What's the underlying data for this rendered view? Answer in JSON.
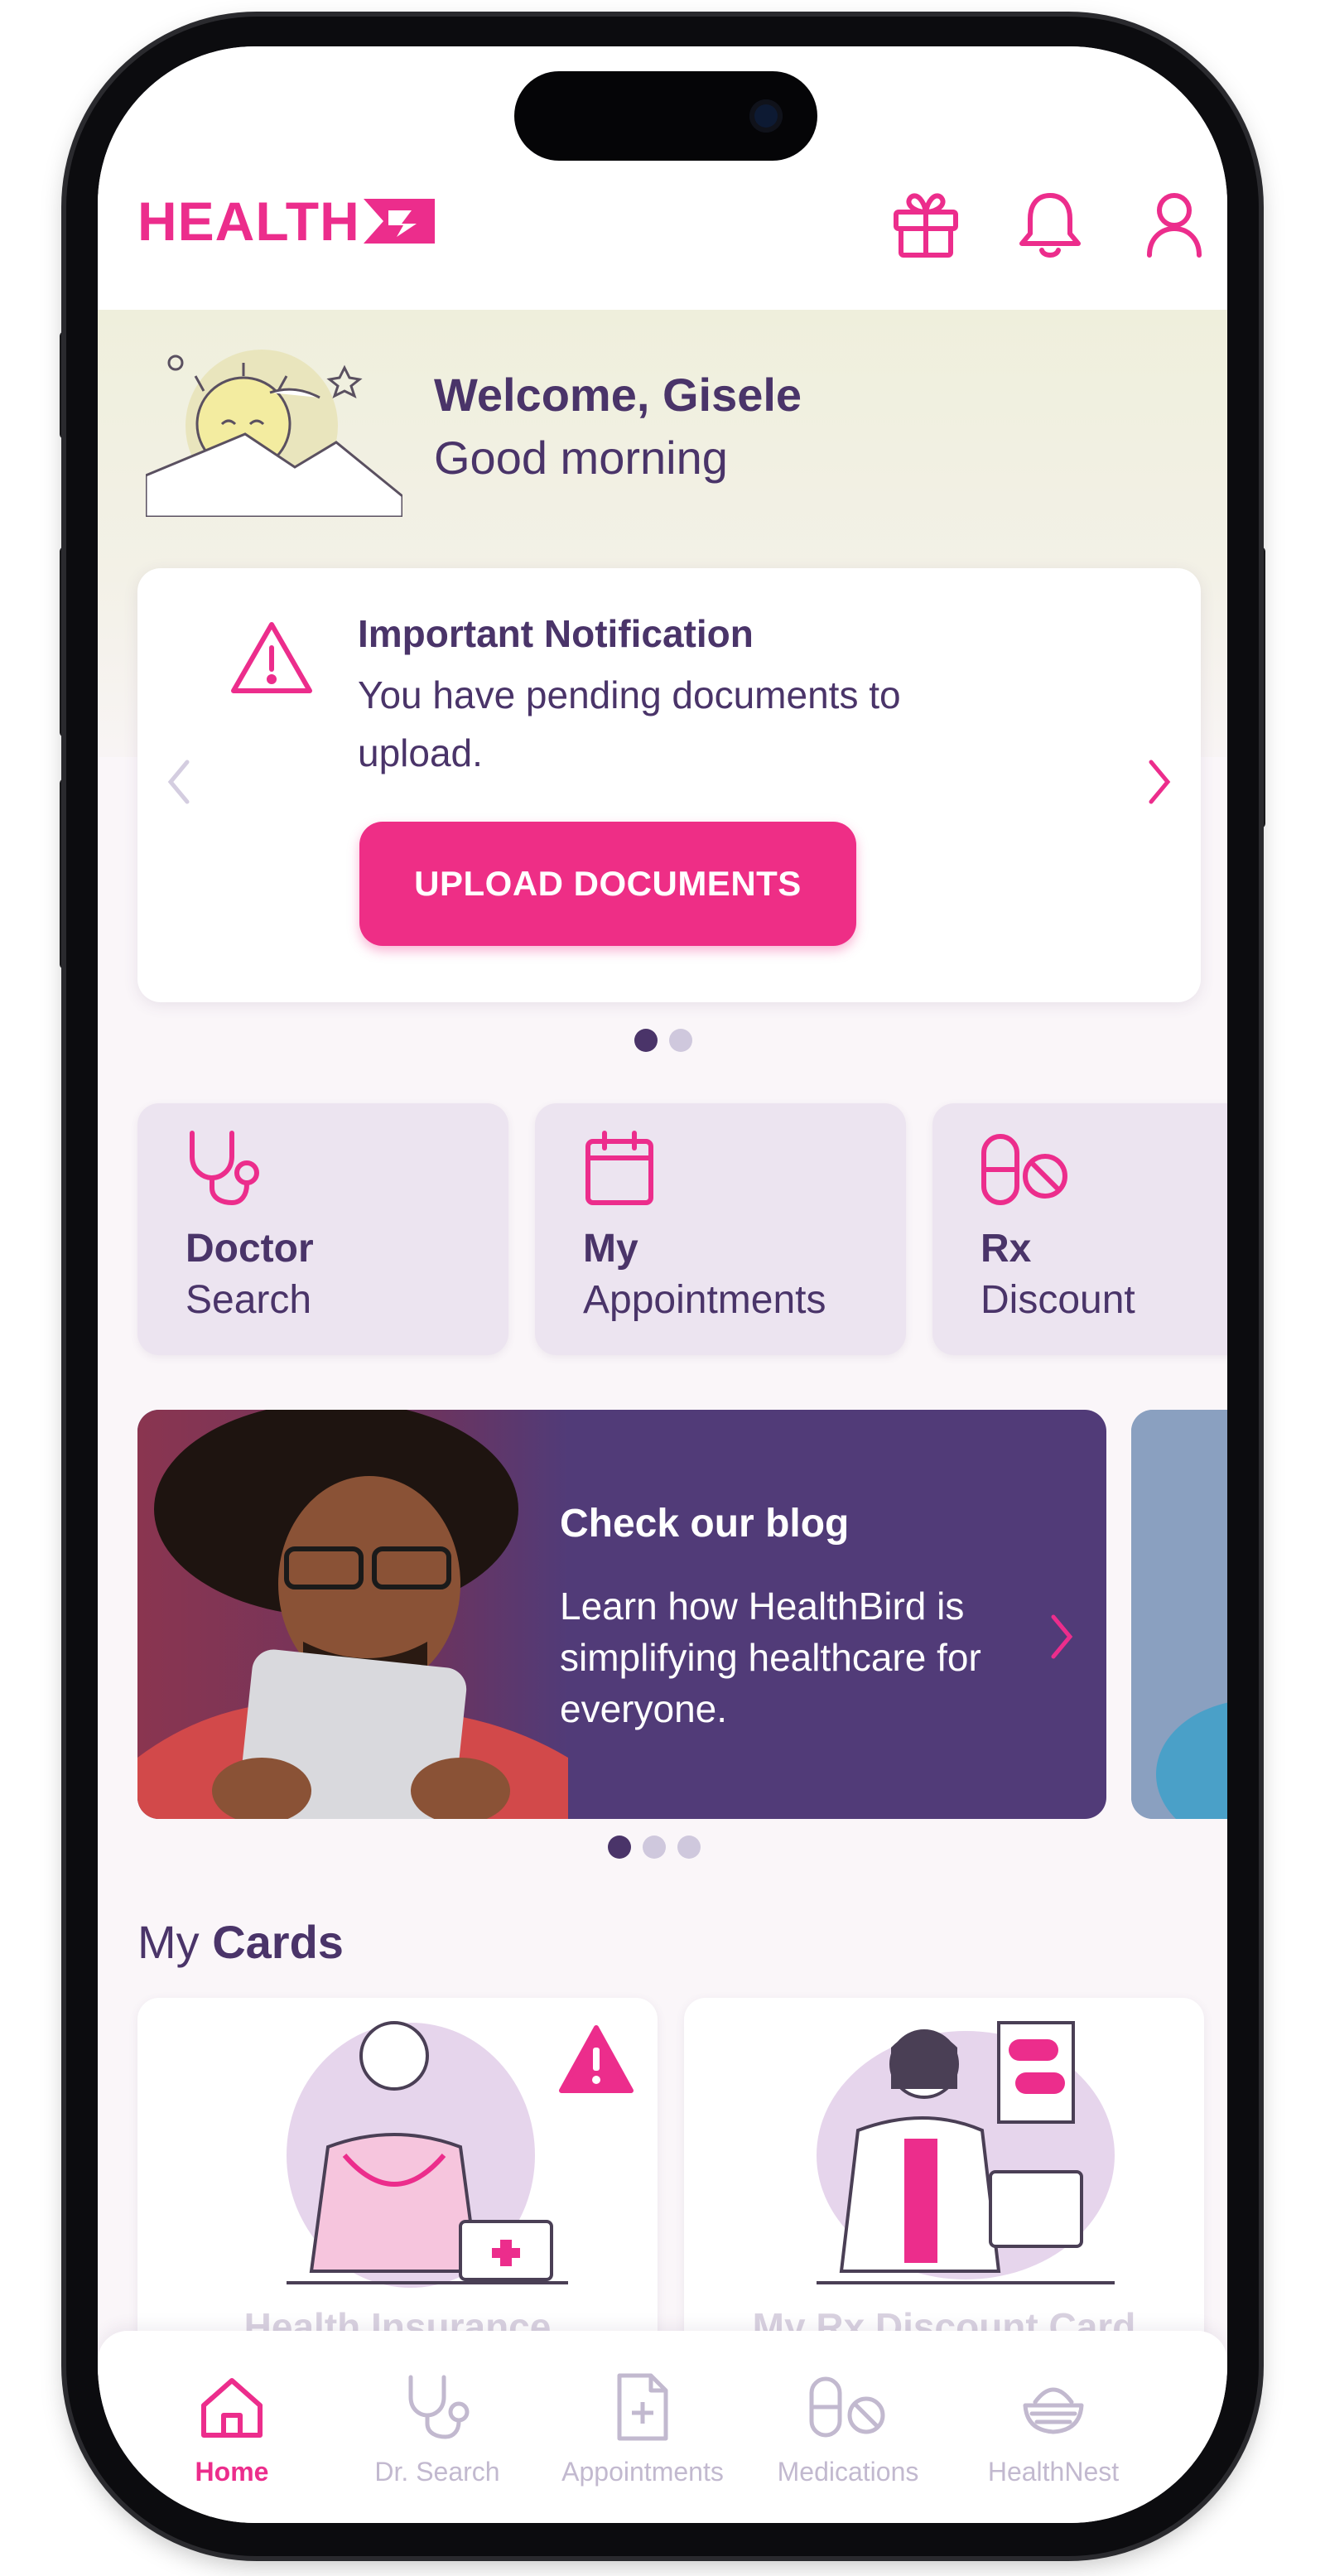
{
  "header": {
    "logo_text": "HEALTH",
    "icons": [
      "gift-icon",
      "bell-icon",
      "user-icon"
    ],
    "accent_color": "#ec2d8c"
  },
  "welcome": {
    "title": "Welcome, Gisele",
    "subtitle": "Good morning"
  },
  "notification": {
    "title": "Important Notification",
    "body": "You have pending documents to upload.",
    "button_label": "UPLOAD DOCUMENTS",
    "carousel_pages": 2,
    "carousel_active": 1
  },
  "quick_actions": [
    {
      "title": "Doctor",
      "subtitle": "Search",
      "icon": "stethoscope-icon"
    },
    {
      "title": "My",
      "subtitle": "Appointments",
      "icon": "calendar-icon"
    },
    {
      "title": "Rx",
      "subtitle": "Discount",
      "icon": "pills-icon"
    }
  ],
  "blog": {
    "title": "Check our blog",
    "body": "Learn how HealthBird is simplifying healthcare for everyone.",
    "carousel_pages": 3,
    "carousel_active": 1
  },
  "my_cards": {
    "title_prefix": "My",
    "title_bold": "Cards",
    "cards": [
      {
        "label": "Health Insurance",
        "warning": true
      },
      {
        "label": "My Rx Discount Card",
        "warning": false
      }
    ]
  },
  "tabbar": {
    "items": [
      {
        "label": "Home",
        "icon": "home-icon",
        "active": true
      },
      {
        "label": "Dr. Search",
        "icon": "stethoscope-icon",
        "active": false
      },
      {
        "label": "Appointments",
        "icon": "document-plus-icon",
        "active": false
      },
      {
        "label": "Medications",
        "icon": "pills-icon",
        "active": false
      },
      {
        "label": "HealthNest",
        "icon": "nest-icon",
        "active": false
      }
    ]
  },
  "colors": {
    "primary_pink": "#ec2d8c",
    "deep_purple": "#4a3469",
    "blog_purple": "#513b78",
    "tile_bg": "#ece4f0"
  }
}
